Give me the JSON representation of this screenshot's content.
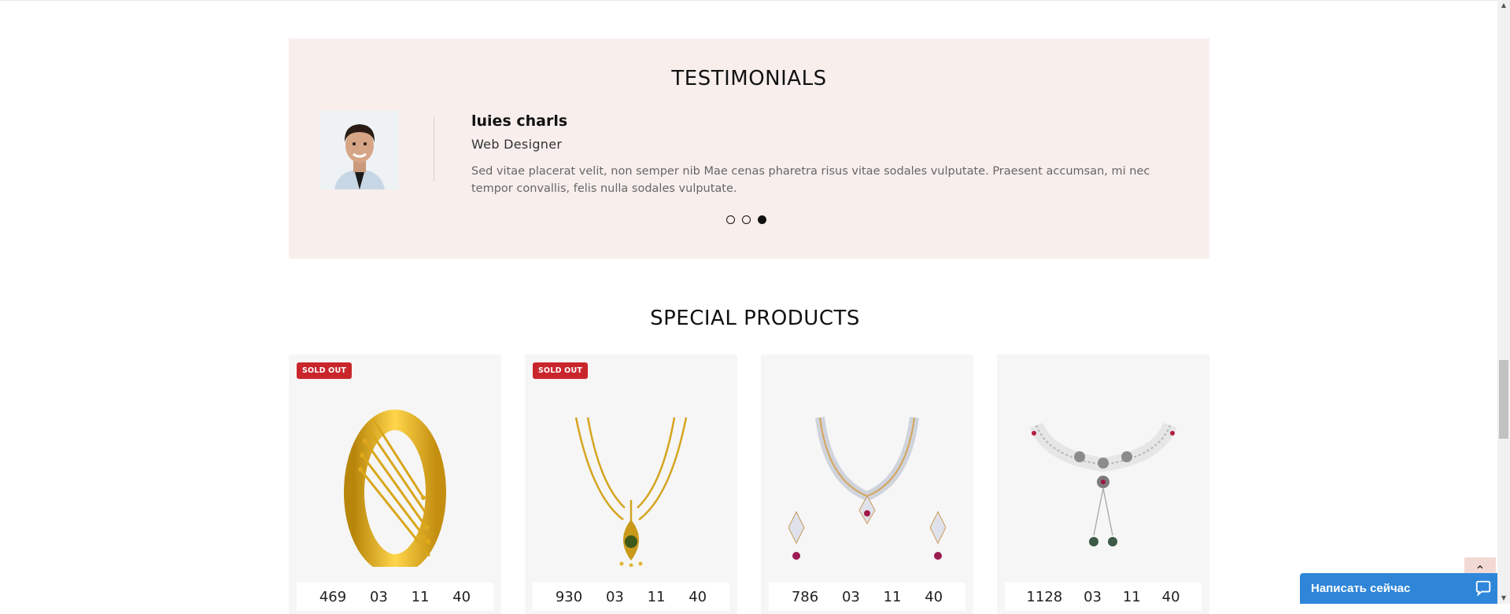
{
  "testimonials": {
    "title": "TESTIMONIALS",
    "name": "luies charls",
    "role": "Web Designer",
    "text": "Sed vitae placerat velit, non semper nib Mae cenas pharetra risus vitae sodales vulputate. Praesent accumsan, mi nec tempor convallis, felis nulla sodales vulputate.",
    "slides": 3,
    "active_slide": 3
  },
  "special": {
    "title": "SPECIAL PRODUCTS",
    "products": [
      {
        "badge": "SOLD OUT",
        "image": "gold-bangle",
        "timer": [
          "469",
          "03",
          "11",
          "40"
        ]
      },
      {
        "badge": "SOLD OUT",
        "image": "gold-maang-tikka",
        "timer": [
          "930",
          "03",
          "11",
          "40"
        ]
      },
      {
        "badge": "",
        "image": "diamond-necklace-set",
        "timer": [
          "786",
          "03",
          "11",
          "40"
        ]
      },
      {
        "badge": "",
        "image": "kundan-choker-set",
        "timer": [
          "1128",
          "03",
          "11",
          "40"
        ]
      }
    ]
  },
  "back_to_top": {
    "icon": "chevron-up-icon"
  },
  "chat": {
    "label": "Написать сейчас",
    "icon": "chat-bubble-icon",
    "color": "#2f86d9"
  },
  "colors": {
    "testimonial_bg": "#f8efed",
    "badge": "#c9262c",
    "card_bg": "#f6f6f6"
  }
}
